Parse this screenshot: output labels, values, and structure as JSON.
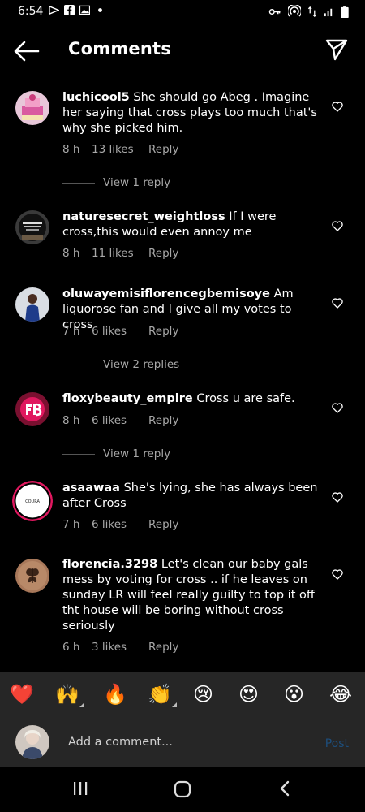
{
  "status_bar": {
    "time": "6:54",
    "left_icons": [
      "location-icon",
      "facebook-icon",
      "gallery-icon",
      "dot-icon"
    ],
    "right_icons": [
      "key-icon",
      "hotspot-icon",
      "data-icon",
      "signal-icon",
      "battery-icon"
    ]
  },
  "header": {
    "title": "Comments",
    "back_icon": "arrow-left-icon",
    "share_icon": "send-icon"
  },
  "comments": [
    {
      "username": "luchicool5",
      "text": "She should go Abeg . Imagine her saying that cross plays too much that's why she picked him.",
      "time": "8 h",
      "likes": "13 likes",
      "reply_label": "Reply",
      "view_replies": "View 1 reply"
    },
    {
      "username": "naturesecret_weightloss",
      "text": "If I were cross,this would even annoy me",
      "time": "8 h",
      "likes": "11 likes",
      "reply_label": "Reply"
    },
    {
      "username": "oluwayemisiflorencegbemisoye",
      "text": "Am liquorose fan and I give all my votes to cross",
      "time": "7 h",
      "likes": "6 likes",
      "reply_label": "Reply",
      "view_replies": "View 2 replies"
    },
    {
      "username": "floxybeauty_empire",
      "text": "Cross u are safe.",
      "time": "8 h",
      "likes": "6 likes",
      "reply_label": "Reply",
      "view_replies": "View 1 reply"
    },
    {
      "username": "asaawaa",
      "text": "She's lying, she has always been after Cross",
      "time": "7 h",
      "likes": "6 likes",
      "reply_label": "Reply"
    },
    {
      "username": "florencia.3298",
      "text": "Let's clean our baby gals mess  by voting for cross .. if he leaves on sunday  LR will feel really guilty to top it off tht house will be boring without cross seriously",
      "time": "6 h",
      "likes": "3 likes",
      "reply_label": "Reply"
    }
  ],
  "avatars": {
    "a5_text": "COURA"
  },
  "reactions": [
    "❤️",
    "🙌",
    "🔥",
    "👏",
    "😢",
    "😍",
    "😮",
    "😂"
  ],
  "composer": {
    "placeholder": "Add a comment...",
    "post_label": "Post"
  },
  "colors": {
    "background": "#000000",
    "secondary_text": "#a8a8a8",
    "bar_background": "#262626",
    "post_disabled": "#1d4e7c"
  }
}
